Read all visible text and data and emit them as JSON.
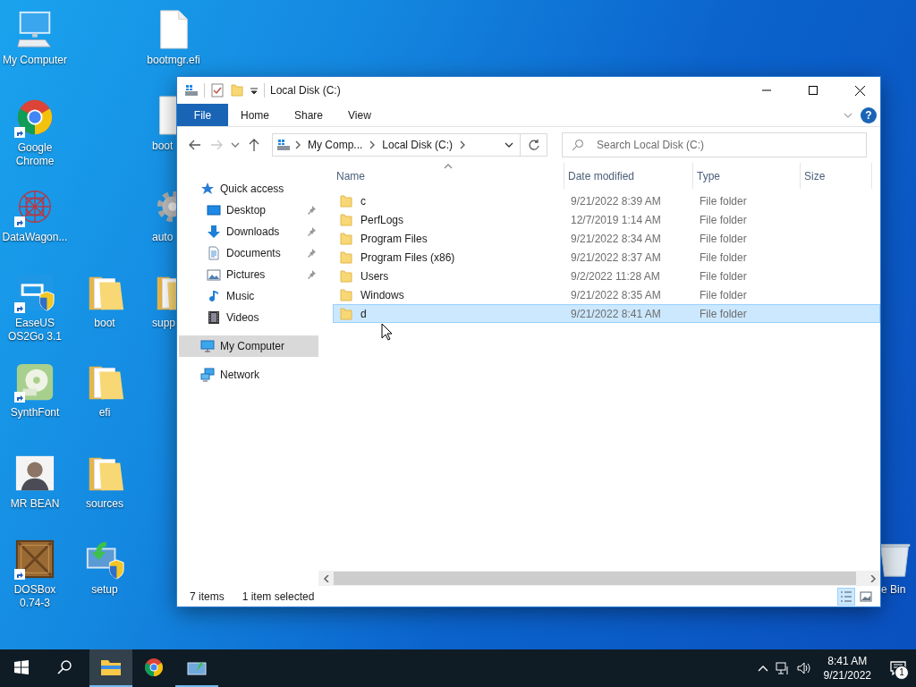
{
  "desktop_icons": [
    {
      "label": "My Computer",
      "kind": "computer",
      "shortcut": false
    },
    {
      "label": "Google Chrome",
      "kind": "browser",
      "shortcut": true
    },
    {
      "label": "DataWagon...",
      "kind": "pattern",
      "shortcut": true
    },
    {
      "label": "EaseUS OS2Go 3.1",
      "kind": "app",
      "shortcut": true
    },
    {
      "label": "SynthFont",
      "kind": "disc",
      "shortcut": true
    },
    {
      "label": "MR BEAN",
      "kind": "person",
      "shortcut": false
    },
    {
      "label": "DOSBox 0.74-3",
      "kind": "crate",
      "shortcut": true
    },
    {
      "label": "boot",
      "kind": "folder",
      "shortcut": false
    },
    {
      "label": "efi",
      "kind": "folder",
      "shortcut": false
    },
    {
      "label": "sources",
      "kind": "folder",
      "shortcut": false
    },
    {
      "label": "setup",
      "kind": "setup",
      "shortcut": false
    },
    {
      "label": "bootmgr.efi",
      "kind": "file",
      "shortcut": false
    },
    {
      "label": "boot",
      "kind": "file",
      "shortcut": false
    },
    {
      "label": "auto",
      "kind": "gear",
      "shortcut": false
    },
    {
      "label": "supp",
      "kind": "folder",
      "shortcut": false
    },
    {
      "label": "e Bin",
      "kind": "bin",
      "shortcut": false
    }
  ],
  "window": {
    "title": "Local Disk (C:)",
    "ribbon_tabs": [
      {
        "label": "File",
        "kind": "menu"
      },
      {
        "label": "Home",
        "kind": "tab"
      },
      {
        "label": "Share",
        "kind": "tab"
      },
      {
        "label": "View",
        "kind": "tab"
      }
    ],
    "help": "?",
    "address": {
      "crumbs": [
        "My Comp...",
        "Local Disk (C:)"
      ]
    },
    "search": {
      "placeholder": "Search Local Disk (C:)"
    },
    "nav": [
      {
        "label": "Quick access",
        "kind": "star",
        "selected": false,
        "children": [
          {
            "label": "Desktop",
            "kind": "desktop",
            "pinned": true,
            "selected": false
          },
          {
            "label": "Downloads",
            "kind": "download",
            "pinned": true,
            "selected": false
          },
          {
            "label": "Documents",
            "kind": "document",
            "pinned": true,
            "selected": false
          },
          {
            "label": "Pictures",
            "kind": "pictures",
            "pinned": true,
            "selected": false
          },
          {
            "label": "Music",
            "kind": "music",
            "pinned": false,
            "selected": false
          },
          {
            "label": "Videos",
            "kind": "videos",
            "pinned": false,
            "selected": false
          }
        ]
      },
      {
        "label": "My Computer",
        "kind": "computer",
        "selected": true
      },
      {
        "label": "Network",
        "kind": "network",
        "selected": false
      }
    ],
    "columns": [
      {
        "label": "Name",
        "sorted": true
      },
      {
        "label": "Date modified",
        "sorted": false
      },
      {
        "label": "Type",
        "sorted": false
      },
      {
        "label": "Size",
        "sorted": false
      }
    ],
    "rows": [
      {
        "name": "c",
        "date": "9/21/2022 8:39 AM",
        "type": "File folder",
        "selected": false
      },
      {
        "name": "PerfLogs",
        "date": "12/7/2019 1:14 AM",
        "type": "File folder",
        "selected": false
      },
      {
        "name": "Program Files",
        "date": "9/21/2022 8:34 AM",
        "type": "File folder",
        "selected": false
      },
      {
        "name": "Program Files (x86)",
        "date": "9/21/2022 8:37 AM",
        "type": "File folder",
        "selected": false
      },
      {
        "name": "Users",
        "date": "9/2/2022 11:28 AM",
        "type": "File folder",
        "selected": false
      },
      {
        "name": "Windows",
        "date": "9/21/2022 8:35 AM",
        "type": "File folder",
        "selected": false
      },
      {
        "name": "d",
        "date": "9/21/2022 8:41 AM",
        "type": "File folder",
        "selected": true
      }
    ],
    "status": {
      "count": "7 items",
      "selection": "1 item selected"
    },
    "view_buttons": [
      {
        "kind": "details",
        "selected": true
      },
      {
        "kind": "thumbnails",
        "selected": false
      }
    ]
  },
  "taskbar": {
    "apps": [
      {
        "kind": "explorer",
        "active": true,
        "running": true
      },
      {
        "kind": "browser",
        "active": false,
        "running": false
      },
      {
        "kind": "app",
        "active": false,
        "running": true
      }
    ],
    "time": "8:41 AM",
    "date": "9/21/2022",
    "notifications": "1"
  }
}
